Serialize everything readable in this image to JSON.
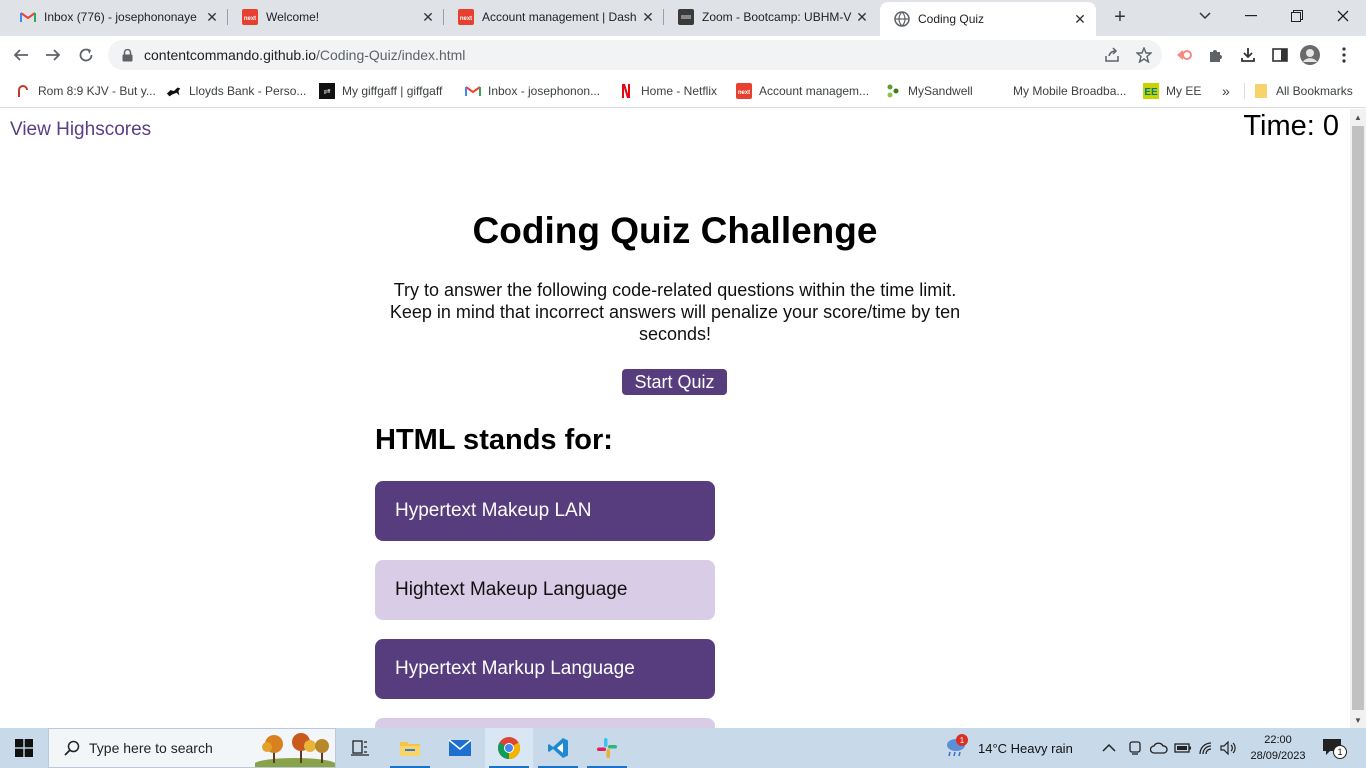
{
  "browser": {
    "tabs": [
      {
        "title": "Inbox (776) - josephononaye",
        "icon": "gmail-icon",
        "left": 0
      },
      {
        "title": "Welcome!",
        "icon": "next-icon"
      },
      {
        "title": "Account management | Dash",
        "icon": "next-icon"
      },
      {
        "title": "Zoom - Bootcamp: UBHM-V",
        "icon": "zoom-icon"
      },
      {
        "title": "Coding Quiz",
        "icon": "globe-icon",
        "active": true
      }
    ],
    "new_tab_label": "+",
    "window_controls": {
      "dropdown": "⌄",
      "minimize": "—",
      "restore": "❐",
      "close": "✕"
    },
    "url_host": "contentcommando.github.io",
    "url_path": "/Coding-Quiz/index.html",
    "bookmarks": [
      {
        "label": "Rom 8:9 KJV - But y...",
        "icon": "bible-icon"
      },
      {
        "label": "Lloyds Bank - Perso...",
        "icon": "lloyds-horse-icon"
      },
      {
        "label": "My giffgaff | giffgaff",
        "icon": "giffgaff-icon"
      },
      {
        "label": "Inbox - josephonon...",
        "icon": "gmail-icon"
      },
      {
        "label": "Home - Netflix",
        "icon": "netflix-icon"
      },
      {
        "label": "Account managem...",
        "icon": "next-icon"
      },
      {
        "label": "MySandwell",
        "icon": "sandwell-icon"
      },
      {
        "label": "My Mobile Broadba...",
        "icon": "blank-icon"
      },
      {
        "label": "My EE",
        "icon": "ee-icon"
      }
    ],
    "bookmarks_overflow": "»",
    "all_bookmarks": "All Bookmarks"
  },
  "page": {
    "view_highscores": "View Highscores",
    "timer": "Time: 0",
    "title": "Coding Quiz Challenge",
    "description": "Try to answer the following code-related questions within the time limit. Keep in mind that incorrect answers will penalize your score/time by ten seconds!",
    "start_button": "Start Quiz",
    "question": "HTML stands for:",
    "choices": [
      {
        "label": "Hypertext Makeup LAN",
        "style": "dark"
      },
      {
        "label": "Hightext Makeup Language",
        "style": "light"
      },
      {
        "label": "Hypertext Markup Language",
        "style": "dark"
      },
      {
        "label": "",
        "style": "light"
      }
    ]
  },
  "taskbar": {
    "search_placeholder": "Type here to search",
    "weather": "14°C  Heavy rain",
    "weather_badge": "1",
    "time": "22:00",
    "date": "28/09/2023",
    "notification_count": "1"
  },
  "colors": {
    "accent_purple": "#573d7d",
    "light_purple": "#d8cce6",
    "link_purple": "#5a3e85"
  }
}
